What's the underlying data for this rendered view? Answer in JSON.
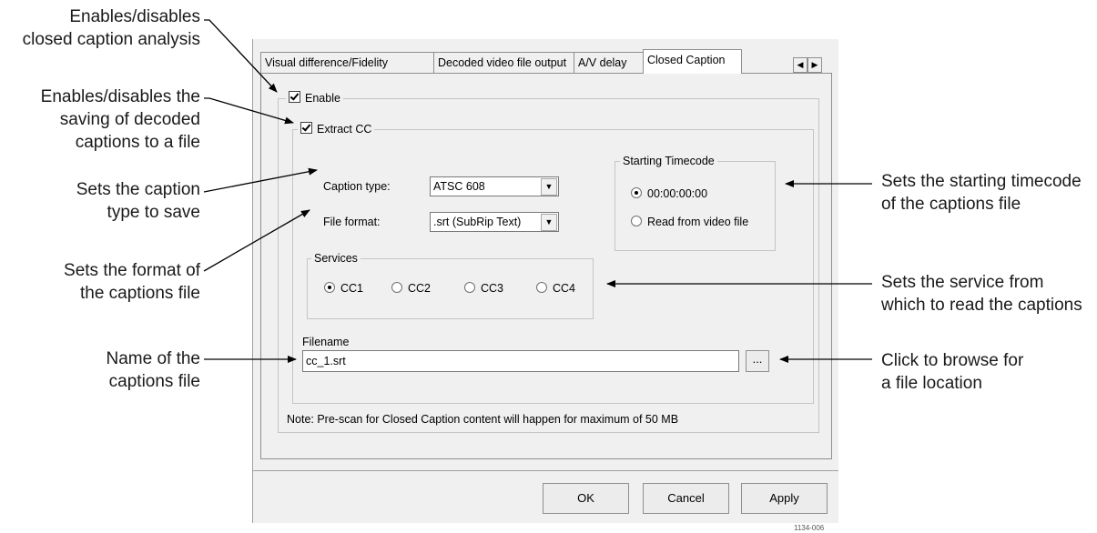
{
  "callouts": {
    "enable_cc": [
      "Enables/disables",
      "closed caption analysis"
    ],
    "extract_cc": [
      "Enables/disables the",
      "saving of decoded",
      "captions to a file"
    ],
    "caption_type": [
      "Sets the caption",
      "type to save"
    ],
    "file_format": [
      "Sets the format of",
      "the captions file"
    ],
    "filename": [
      "Name of the",
      "captions file"
    ],
    "timecode": [
      "Sets the starting timecode",
      "of the captions file"
    ],
    "services": [
      "Sets the service from",
      "which to read the captions"
    ],
    "browse": [
      "Click to browse for",
      "a file location"
    ]
  },
  "tabs": [
    "Visual difference/Fidelity",
    "Decoded video file output",
    "A/V delay",
    "Closed Caption"
  ],
  "tab_scroll": {
    "left": "◀",
    "right": "▶"
  },
  "enable_label": "Enable",
  "extract_label": "Extract CC",
  "caption_type": {
    "label": "Caption type:",
    "value": "ATSC 608"
  },
  "file_format": {
    "label": "File format:",
    "value": ".srt (SubRip Text)"
  },
  "starting_timecode": {
    "title": "Starting Timecode",
    "options": [
      "00:00:00:00",
      "Read from video file"
    ],
    "selected": 0
  },
  "services": {
    "title": "Services",
    "options": [
      "CC1",
      "CC2",
      "CC3",
      "CC4"
    ],
    "selected": 0
  },
  "filename": {
    "label": "Filename",
    "value": "cc_1.srt",
    "browse_label": "..."
  },
  "note": "Note: Pre-scan for Closed Caption content will happen for maximum of 50 MB",
  "buttons": {
    "ok": "OK",
    "cancel": "Cancel",
    "apply": "Apply"
  },
  "figure_id": "1134-006"
}
